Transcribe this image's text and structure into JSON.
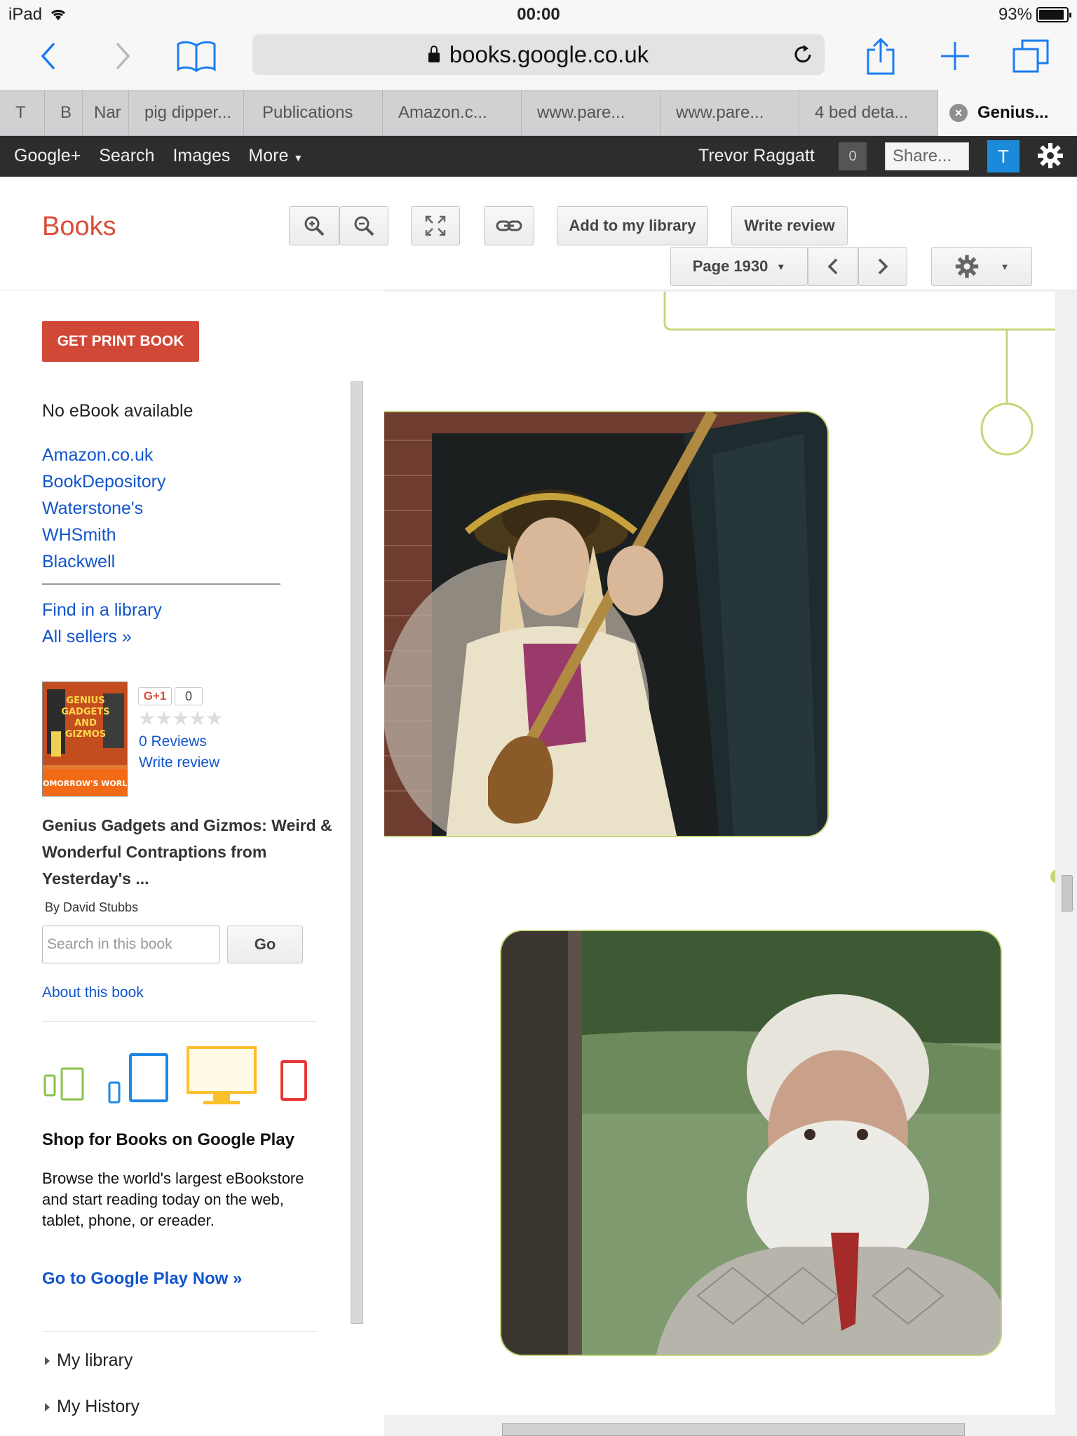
{
  "status_bar": {
    "device": "iPad",
    "time": "00:00",
    "battery": "93%",
    "battery_level": 0.93
  },
  "browser": {
    "url": "books.google.co.uk",
    "tabs": [
      {
        "label": "T"
      },
      {
        "label": "B"
      },
      {
        "label": "Nar"
      },
      {
        "label": "pig dipper..."
      },
      {
        "label": "Publications"
      },
      {
        "label": "Amazon.c..."
      },
      {
        "label": "www.pare..."
      },
      {
        "label": "www.pare..."
      },
      {
        "label": "4 bed deta..."
      },
      {
        "label": "Genius..."
      }
    ]
  },
  "gbar": {
    "links": [
      "Google+",
      "Search",
      "Images",
      "More"
    ],
    "user": "Trevor Raggatt",
    "notifications": "0",
    "share": "Share...",
    "avatar": "T"
  },
  "books_header": {
    "title": "Books",
    "add_library": "Add to my library",
    "write_review": "Write review",
    "page": "Page 1930"
  },
  "sidebar": {
    "get_print": "GET PRINT BOOK",
    "no_ebook": "No eBook available",
    "sellers": [
      "Amazon.co.uk",
      "BookDepository",
      "Waterstone's",
      "WHSmith",
      "Blackwell"
    ],
    "find_library": "Find in a library",
    "all_sellers": "All sellers »",
    "gplus_count": "0",
    "reviews": "0 Reviews",
    "write_review": "Write review",
    "book_title": "Genius Gadgets and Gizmos: Weird & Wonderful Contraptions from Yesterday's ...",
    "byline": "By David Stubbs",
    "search_placeholder": "Search in this book",
    "go": "Go",
    "about": "About this book",
    "shop_title": "Shop for Books on Google Play",
    "shop_desc": "Browse the world's largest eBookstore and start reading today on the web, tablet, phone, or ereader.",
    "play_link": "Go to Google Play Now »",
    "menu": [
      "My library",
      "My History"
    ]
  },
  "cover": {
    "lettering": [
      "GENIUS",
      "GADGETS",
      "AND",
      "GIZMOS",
      "TOMORROW'S WORLD"
    ]
  },
  "colors": {
    "accent_red": "#dd4b39",
    "link_blue": "#1155cc",
    "gbar_bg": "#2d2d2d",
    "print_button": "#d14836",
    "page_accent": "#c6d77a"
  }
}
